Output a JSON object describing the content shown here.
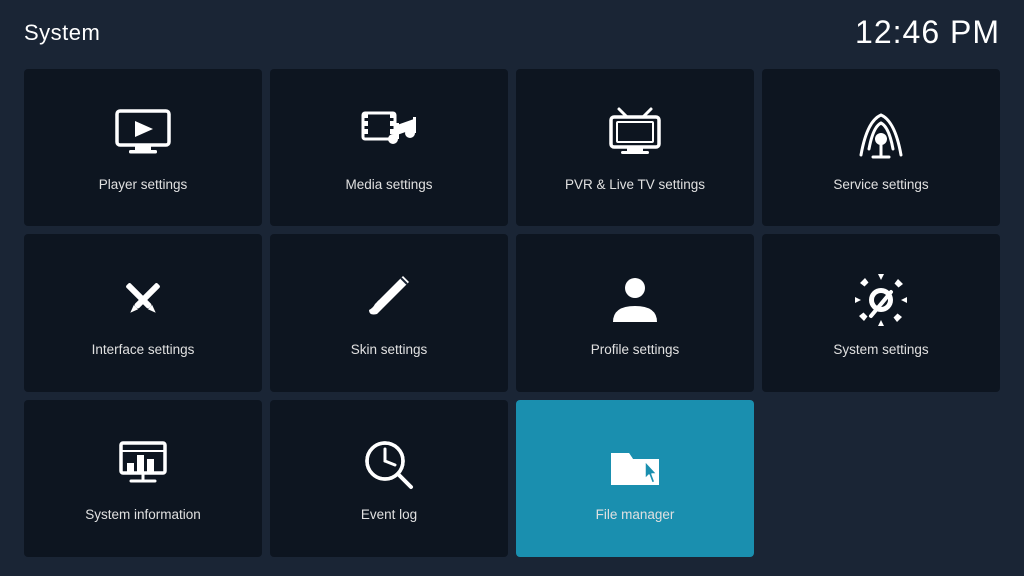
{
  "header": {
    "title": "System",
    "time": "12:46 PM"
  },
  "tiles": [
    {
      "id": "player-settings",
      "label": "Player settings",
      "icon": "player",
      "active": false
    },
    {
      "id": "media-settings",
      "label": "Media settings",
      "icon": "media",
      "active": false
    },
    {
      "id": "pvr-settings",
      "label": "PVR & Live TV settings",
      "icon": "pvr",
      "active": false
    },
    {
      "id": "service-settings",
      "label": "Service settings",
      "icon": "service",
      "active": false
    },
    {
      "id": "interface-settings",
      "label": "Interface settings",
      "icon": "interface",
      "active": false
    },
    {
      "id": "skin-settings",
      "label": "Skin settings",
      "icon": "skin",
      "active": false
    },
    {
      "id": "profile-settings",
      "label": "Profile settings",
      "icon": "profile",
      "active": false
    },
    {
      "id": "system-settings",
      "label": "System settings",
      "icon": "system",
      "active": false
    },
    {
      "id": "system-information",
      "label": "System information",
      "icon": "sysinfo",
      "active": false
    },
    {
      "id": "event-log",
      "label": "Event log",
      "icon": "eventlog",
      "active": false
    },
    {
      "id": "file-manager",
      "label": "File manager",
      "icon": "filemanager",
      "active": true
    }
  ]
}
